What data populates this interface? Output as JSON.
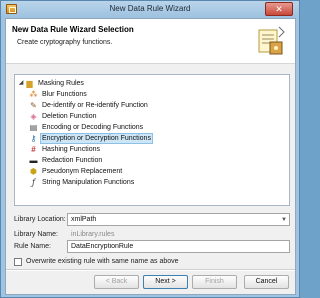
{
  "window": {
    "title": "New Data Rule Wizard",
    "close_glyph": "✕"
  },
  "header": {
    "title": "New Data Rule Wizard Selection",
    "description": "Create cryptography functions."
  },
  "tree": {
    "root": {
      "label": "Masking Rules",
      "icon": "folder-icon",
      "expanded": true
    },
    "items": [
      {
        "label": "Blur Functions",
        "icon": "blur-icon",
        "glyph": "⁂",
        "color": "#d07a1a"
      },
      {
        "label": "De-identify or Re-identify Function",
        "icon": "deidentify-icon",
        "glyph": "✎",
        "color": "#8a5a2a"
      },
      {
        "label": "Deletion Function",
        "icon": "eraser-icon",
        "glyph": "◈",
        "color": "#d46b8c"
      },
      {
        "label": "Encoding or Decoding Functions",
        "icon": "encoding-icon",
        "glyph": "▤",
        "color": "#4a4a4a"
      },
      {
        "label": "Encryption or Decryption Functions",
        "icon": "key-icon",
        "glyph": "⚷",
        "color": "#2d6ea3",
        "selected": true
      },
      {
        "label": "Hashing Functions",
        "icon": "hash-icon",
        "glyph": "#",
        "color": "#c43a3a"
      },
      {
        "label": "Redaction Function",
        "icon": "redaction-icon",
        "glyph": "▬",
        "color": "#222222"
      },
      {
        "label": "Pseudonym Replacement",
        "icon": "pseudonym-icon",
        "glyph": "⬢",
        "color": "#c9a21a"
      },
      {
        "label": "String Manipulation Functions",
        "icon": "function-icon",
        "glyph": "ƒ",
        "color": "#333333"
      }
    ]
  },
  "form": {
    "library_location_label": "Library Location:",
    "library_location_value": "xmlPath",
    "library_name_label": "Library Name:",
    "library_name_value": "inLibrary.rules",
    "rule_name_label": "Rule Name:",
    "rule_name_value": "DataEncryptionRule",
    "overwrite_label": "Overwrite existing rule with same name as above",
    "overwrite_checked": false
  },
  "buttons": {
    "back": "< Back",
    "next": "Next >",
    "finish": "Finish",
    "cancel": "Cancel"
  }
}
